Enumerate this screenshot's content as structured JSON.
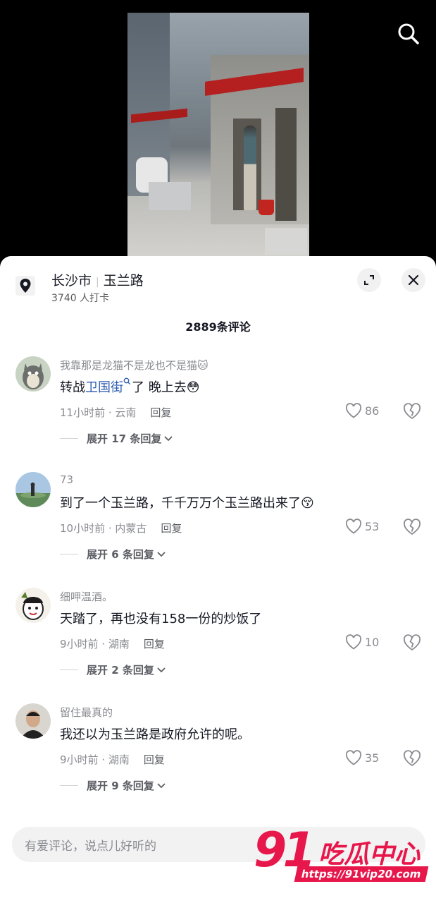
{
  "location": {
    "city": "长沙市",
    "road": "玉兰路",
    "checkins": "3740 人打卡"
  },
  "comments_count": "2889条评论",
  "comments": [
    {
      "user": "我靠那是龙猫不是龙也不是猫🐱",
      "text_before": "转战",
      "link": "卫国街",
      "text_after": "了 晚上去😳",
      "time_place": "11小时前 · 云南",
      "reply": "回复",
      "likes": "86",
      "expand": "展开 17 条回复"
    },
    {
      "user": "73",
      "text": "到了一个玉兰路，千千万万个玉兰路出来了😚",
      "time_place": "10小时前 · 内蒙古",
      "reply": "回复",
      "likes": "53",
      "expand": "展开 6 条回复"
    },
    {
      "user": "细呷温酒。",
      "text": "天踏了，再也没有158一份的炒饭了",
      "time_place": "9小时前 · 湖南",
      "reply": "回复",
      "likes": "10",
      "expand": "展开 2 条回复"
    },
    {
      "user": "留住最真的",
      "text": "我还以为玉兰路是政府允许的呢。",
      "time_place": "9小时前 · 湖南",
      "reply": "回复",
      "likes": "35",
      "expand": "展开 9 条回复"
    }
  ],
  "input": {
    "placeholder": "有爱评论，说点儿好听的"
  },
  "watermark": {
    "number": "91",
    "name": "吃瓜中心",
    "url": "https://91vip20.com"
  },
  "icons": [
    "search-icon",
    "location-pin-icon",
    "expand-icon",
    "close-icon",
    "heart-icon",
    "broken-heart-icon",
    "chevron-down-icon"
  ]
}
